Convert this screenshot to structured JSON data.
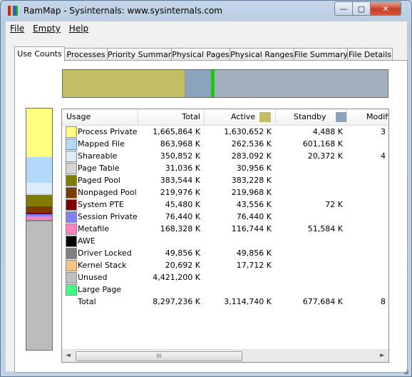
{
  "window": {
    "title": "RamMap - Sysinternals: www.sysinternals.com"
  },
  "controls": {
    "minimize": "—",
    "maximize": "▢",
    "close": "✕"
  },
  "menu": [
    "File",
    "Empty",
    "Help"
  ],
  "tabs": [
    "Use Counts",
    "Processes",
    "Priority Summary",
    "Physical Pages",
    "Physical Ranges",
    "File Summary",
    "File Details"
  ],
  "colors": {
    "active": "#c0bd62",
    "standby": "#8ca3bd",
    "modified": "#22c222",
    "free": "#a2b1bd",
    "unused": "#bcbcbc"
  },
  "usage_bar": {
    "active": 0.376,
    "standby": 0.082,
    "modified": 0.01,
    "free": 0.532
  },
  "columns": [
    "Usage",
    "Total",
    "Active",
    "Standby",
    "Modifie"
  ],
  "rows": [
    {
      "name": "Process Private",
      "color": "#ffff80",
      "total": "1,665,864 K",
      "active": "1,630,652 K",
      "standby": "4,488 K",
      "modified": "3"
    },
    {
      "name": "Mapped File",
      "color": "#b2d8fc",
      "total": "863,968 K",
      "active": "262,536 K",
      "standby": "601,168 K",
      "modified": ""
    },
    {
      "name": "Shareable",
      "color": "#dcecfb",
      "total": "350,852 K",
      "active": "283,092 K",
      "standby": "20,372 K",
      "modified": "4"
    },
    {
      "name": "Page Table",
      "color": "#d4d4d4",
      "total": "31,036 K",
      "active": "30,956 K",
      "standby": "",
      "modified": ""
    },
    {
      "name": "Paged Pool",
      "color": "#807c00",
      "total": "383,544 K",
      "active": "383,228 K",
      "standby": "",
      "modified": ""
    },
    {
      "name": "Nonpaged Pool",
      "color": "#7c3c00",
      "total": "219,976 K",
      "active": "219,968 K",
      "standby": "",
      "modified": ""
    },
    {
      "name": "System PTE",
      "color": "#800000",
      "total": "45,480 K",
      "active": "43,556 K",
      "standby": "72 K",
      "modified": ""
    },
    {
      "name": "Session Private",
      "color": "#8080f8",
      "total": "76,440 K",
      "active": "76,440 K",
      "standby": "",
      "modified": ""
    },
    {
      "name": "Metafile",
      "color": "#ff80c0",
      "total": "168,328 K",
      "active": "116,744 K",
      "standby": "51,584 K",
      "modified": ""
    },
    {
      "name": "AWE",
      "color": "#000000",
      "total": "",
      "active": "",
      "standby": "",
      "modified": ""
    },
    {
      "name": "Driver Locked",
      "color": "#808080",
      "total": "49,856 K",
      "active": "49,856 K",
      "standby": "",
      "modified": ""
    },
    {
      "name": "Kernel Stack",
      "color": "#ffc088",
      "total": "20,692 K",
      "active": "17,712 K",
      "standby": "",
      "modified": ""
    },
    {
      "name": "Unused",
      "color": "#c0c0c0",
      "total": "4,421,200 K",
      "active": "",
      "standby": "",
      "modified": ""
    },
    {
      "name": "Large Page",
      "color": "#40ff80",
      "total": "",
      "active": "",
      "standby": "",
      "modified": ""
    },
    {
      "name": "Total",
      "color": "",
      "total": "8,297,236 K",
      "active": "3,114,740 K",
      "standby": "677,684 K",
      "modified": "8"
    }
  ],
  "scrollbar": {
    "left": "◄",
    "right": "►",
    "thumb": "III",
    "grip": "◢"
  }
}
